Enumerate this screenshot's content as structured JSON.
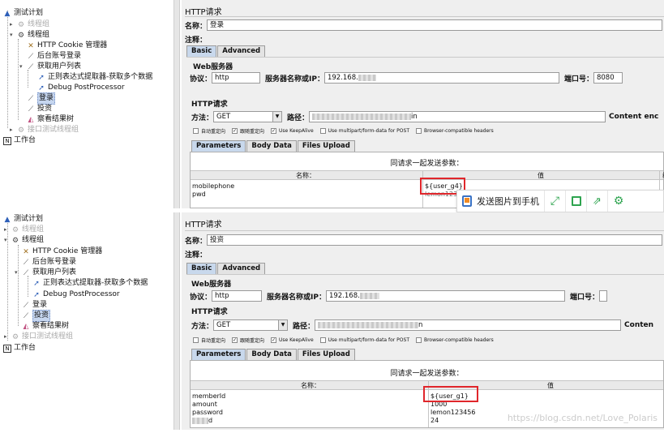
{
  "tree_top": {
    "items": [
      {
        "label": "测试计划",
        "icon": "test-plan-icon",
        "disabled": false
      },
      {
        "label": "线程组",
        "icon": "gear-icon",
        "disabled": true
      },
      {
        "label": "线程组",
        "icon": "gear-icon",
        "disabled": false
      },
      {
        "label": "HTTP Cookie 管理器",
        "icon": "wrench-icon",
        "disabled": false
      },
      {
        "label": "后台账号登录",
        "icon": "sampler-icon",
        "disabled": false
      },
      {
        "label": "获取用户列表",
        "icon": "sampler-icon",
        "disabled": false
      },
      {
        "label": "正则表达式提取器-获取多个数据",
        "icon": "extractor-icon",
        "disabled": false
      },
      {
        "label": "Debug PostProcessor",
        "icon": "extractor-icon",
        "disabled": false
      },
      {
        "label": "登录",
        "icon": "sampler-icon",
        "disabled": false,
        "selected": true
      },
      {
        "label": "投资",
        "icon": "sampler-icon",
        "disabled": false
      },
      {
        "label": "察看结果树",
        "icon": "listener-icon",
        "disabled": false
      },
      {
        "label": "接口测试线程组",
        "icon": "gear-icon",
        "disabled": true
      },
      {
        "label": "工作台",
        "icon": "workbench-icon",
        "disabled": false
      }
    ]
  },
  "tree_bottom": {
    "items": [
      {
        "label": "测试计划",
        "icon": "test-plan-icon",
        "disabled": false
      },
      {
        "label": "线程组",
        "icon": "gear-icon",
        "disabled": true
      },
      {
        "label": "线程组",
        "icon": "gear-icon",
        "disabled": false
      },
      {
        "label": "HTTP Cookie 管理器",
        "icon": "wrench-icon",
        "disabled": false
      },
      {
        "label": "后台账号登录",
        "icon": "sampler-icon",
        "disabled": false
      },
      {
        "label": "获取用户列表",
        "icon": "sampler-icon",
        "disabled": false
      },
      {
        "label": "正则表达式提取器-获取多个数据",
        "icon": "extractor-icon",
        "disabled": false
      },
      {
        "label": "Debug PostProcessor",
        "icon": "extractor-icon",
        "disabled": false
      },
      {
        "label": "登录",
        "icon": "sampler-icon",
        "disabled": false
      },
      {
        "label": "投资",
        "icon": "sampler-icon",
        "disabled": false,
        "selected": true
      },
      {
        "label": "察看结果树",
        "icon": "listener-icon",
        "disabled": false
      },
      {
        "label": "接口测试线程组",
        "icon": "gear-icon",
        "disabled": true
      },
      {
        "label": "工作台",
        "icon": "workbench-icon",
        "disabled": false
      }
    ]
  },
  "top": {
    "title": "HTTP请求",
    "name_label": "名称：",
    "name_value": "登录",
    "comment_label": "注释：",
    "tab_basic": "Basic",
    "tab_advanced": "Advanced",
    "web_server": "Web服务器",
    "protocol_label": "协议：",
    "protocol_value": "http",
    "server_label": "服务器名称或IP：",
    "server_value": "192.168.",
    "port_label": "端口号：",
    "port_value": "8080",
    "http_request": "HTTP请求",
    "method_label": "方法：",
    "method_value": "GET",
    "path_label": "路径：",
    "path_suffix": "in",
    "content_encoding": "Content enc",
    "cb_redirect": "自动重定向",
    "cb_follow": "跟随重定向",
    "cb_keepalive": "Use KeepAlive",
    "cb_multipart": "Use multipart/form-data for POST",
    "cb_browser": "Browser-compatible headers",
    "tab_params": "Parameters",
    "tab_body": "Body Data",
    "tab_files": "Files Upload",
    "params_title": "同请求一起发送参数：",
    "col_name": "名称：",
    "col_value": "值",
    "col_enc": "编",
    "rows": [
      {
        "name": "mobilephone",
        "value": "${user_g4}"
      },
      {
        "name": "pwd",
        "value": "lemon123"
      }
    ]
  },
  "bottom": {
    "title": "HTTP请求",
    "name_label": "名称：",
    "name_value": "投资",
    "comment_label": "注释：",
    "tab_basic": "Basic",
    "tab_advanced": "Advanced",
    "web_server": "Web服务器",
    "protocol_label": "协议：",
    "protocol_value": "http",
    "server_label": "服务器名称或IP：",
    "server_value": "192.168.",
    "port_label": "端口号：",
    "http_request": "HTTP请求",
    "method_label": "方法：",
    "method_value": "GET",
    "path_label": "路径：",
    "path_suffix": "n",
    "content_encoding": "Conten",
    "cb_redirect": "自动重定向",
    "cb_follow": "跟随重定向",
    "cb_keepalive": "Use KeepAlive",
    "cb_multipart": "Use multipart/form-data for POST",
    "cb_browser": "Browser-compatible headers",
    "tab_params": "Parameters",
    "tab_body": "Body Data",
    "tab_files": "Files Upload",
    "params_title": "同请求一起发送参数：",
    "col_name": "名称：",
    "col_value": "值",
    "rows": [
      {
        "name": "memberId",
        "value": "${user_g1}"
      },
      {
        "name": "amount",
        "value": "1000"
      },
      {
        "name": "password",
        "value": "lemon123456"
      },
      {
        "name": "d",
        "value": "24"
      }
    ]
  },
  "share_bar": {
    "send_label": "发送图片到手机"
  },
  "watermark": "https://blog.csdn.net/Love_Polaris",
  "colors": {
    "red_highlight": "#e0262b",
    "tab_active": "#c8d8ec",
    "panel_bg": "#efefef"
  }
}
